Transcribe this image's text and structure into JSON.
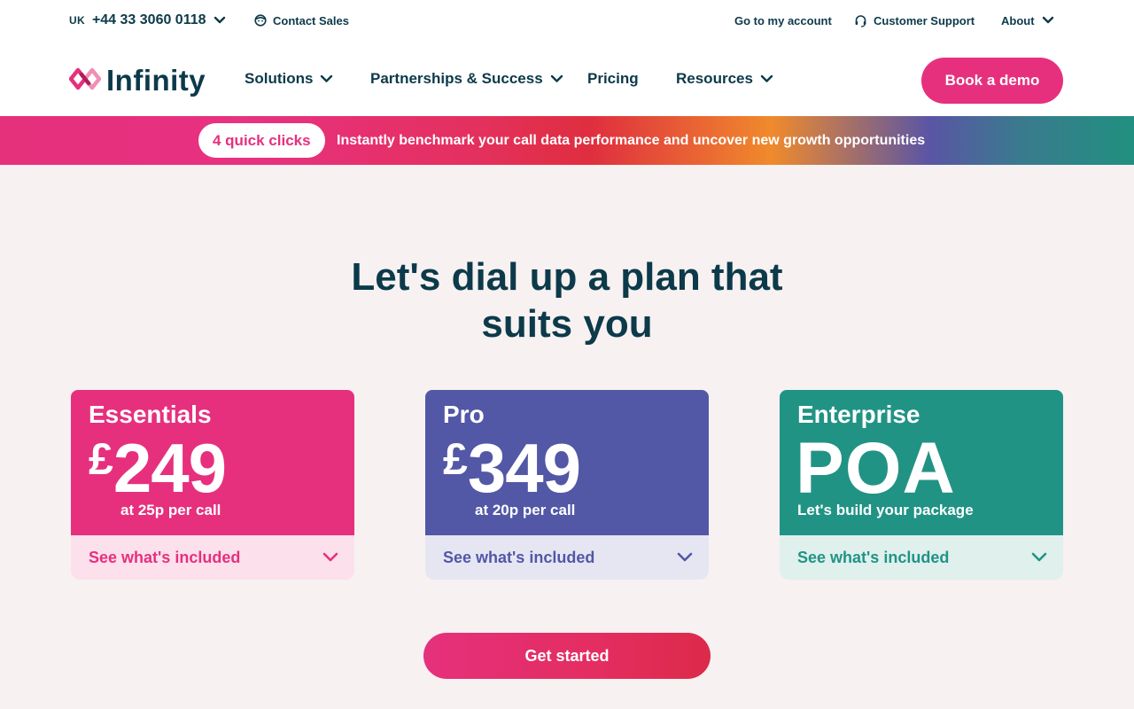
{
  "topbar": {
    "country": "UK",
    "phone": "+44 33 3060 0118",
    "contact_sales": "Contact Sales",
    "account": "Go to my account",
    "support": "Customer Support",
    "about": "About"
  },
  "nav": {
    "logo_text": "Infinity",
    "items": [
      "Solutions",
      "Partnerships & Success",
      "Pricing",
      "Resources"
    ],
    "demo_button": "Book a demo"
  },
  "banner": {
    "pill": "4 quick clicks",
    "text": "Instantly benchmark your call data performance and uncover new growth opportunities"
  },
  "headline": {
    "line1": "Let's dial up a plan that",
    "line2": "suits you"
  },
  "plans": [
    {
      "name": "Essentials",
      "currency": "£",
      "price": "249",
      "note": "at 25p per call",
      "toggle": "See what's included",
      "color": "#e6307e",
      "foot_bg": "#fce0ec",
      "foot_color": "#e6307e"
    },
    {
      "name": "Pro",
      "currency": "£",
      "price": "349",
      "note": "at 20p per call",
      "toggle": "See what's included",
      "color": "#5257a6",
      "foot_bg": "#e6e6f3",
      "foot_color": "#5257a6"
    },
    {
      "name": "Enterprise",
      "price": "POA",
      "note": "Let's build your package",
      "toggle": "See what's included",
      "color": "#219385",
      "foot_bg": "#dff0ed",
      "foot_color": "#219385"
    }
  ],
  "cta": "Get started",
  "icons": {
    "chevron": "chevron-down-icon",
    "contact": "face-icon",
    "support": "headset-icon",
    "logo": "infinity-logo-icon"
  }
}
